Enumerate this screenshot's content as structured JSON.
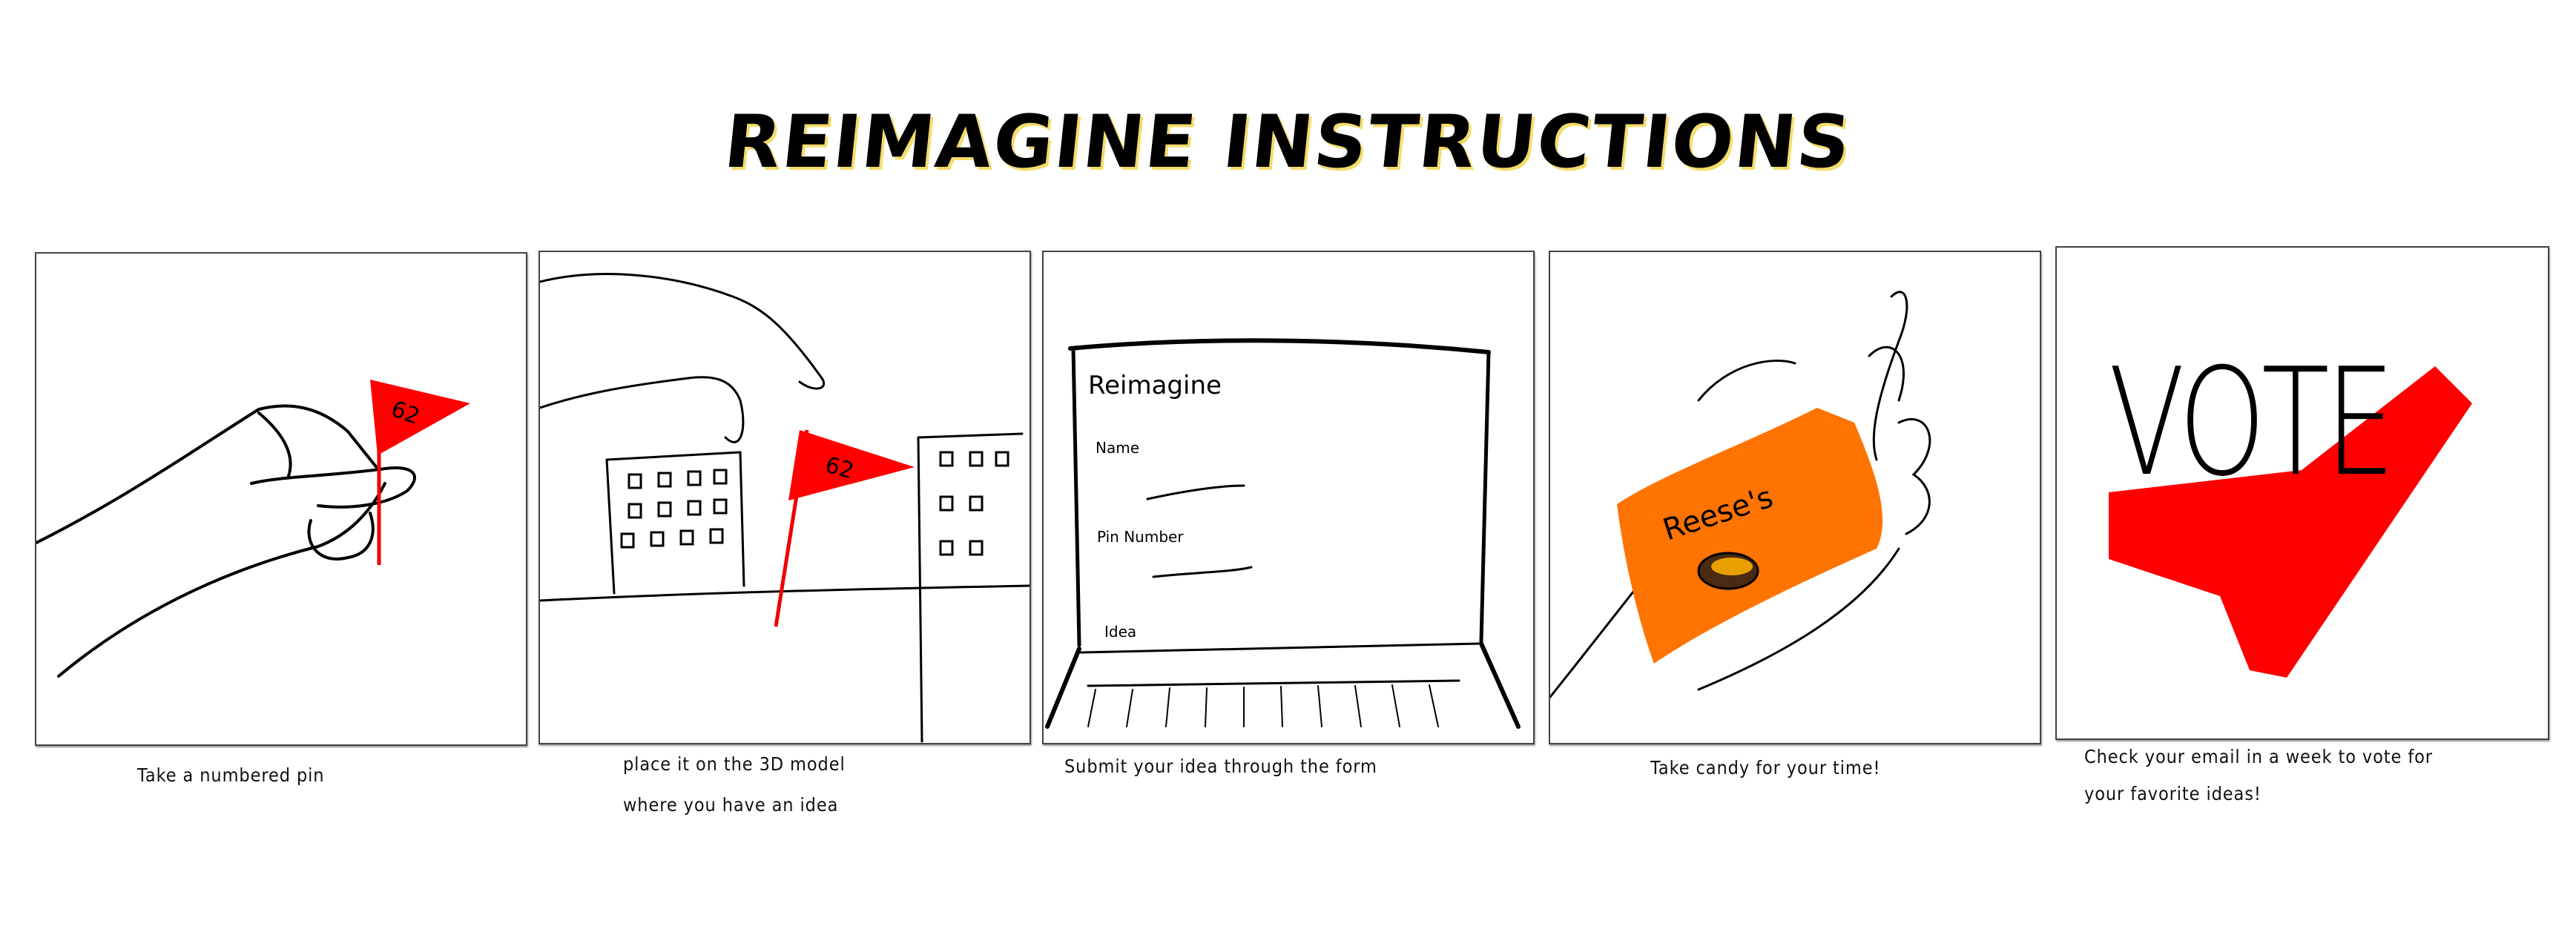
{
  "title": "REIMAGINE INSTRUCTIONS",
  "colors": {
    "flag": "#ff0000",
    "candy": "#ff7300",
    "highlight": "#f3dc6a"
  },
  "panels": [
    {
      "caption": "Take a numbered pin",
      "flag_number": "62"
    },
    {
      "caption_line1": "place it on the 3D model",
      "caption_line2": "where you have an idea",
      "flag_number": "62"
    },
    {
      "caption": "Submit your idea through the form",
      "form": {
        "title": "Reimagine",
        "field1": "Name",
        "field2": "Pin Number",
        "field3": "Idea"
      }
    },
    {
      "caption": "Take candy for your time!",
      "candy_label": "Reese's"
    },
    {
      "caption_line1": "Check your email in a week to vote for",
      "caption_line2": "your favorite ideas!",
      "sign": "VOTE"
    }
  ]
}
